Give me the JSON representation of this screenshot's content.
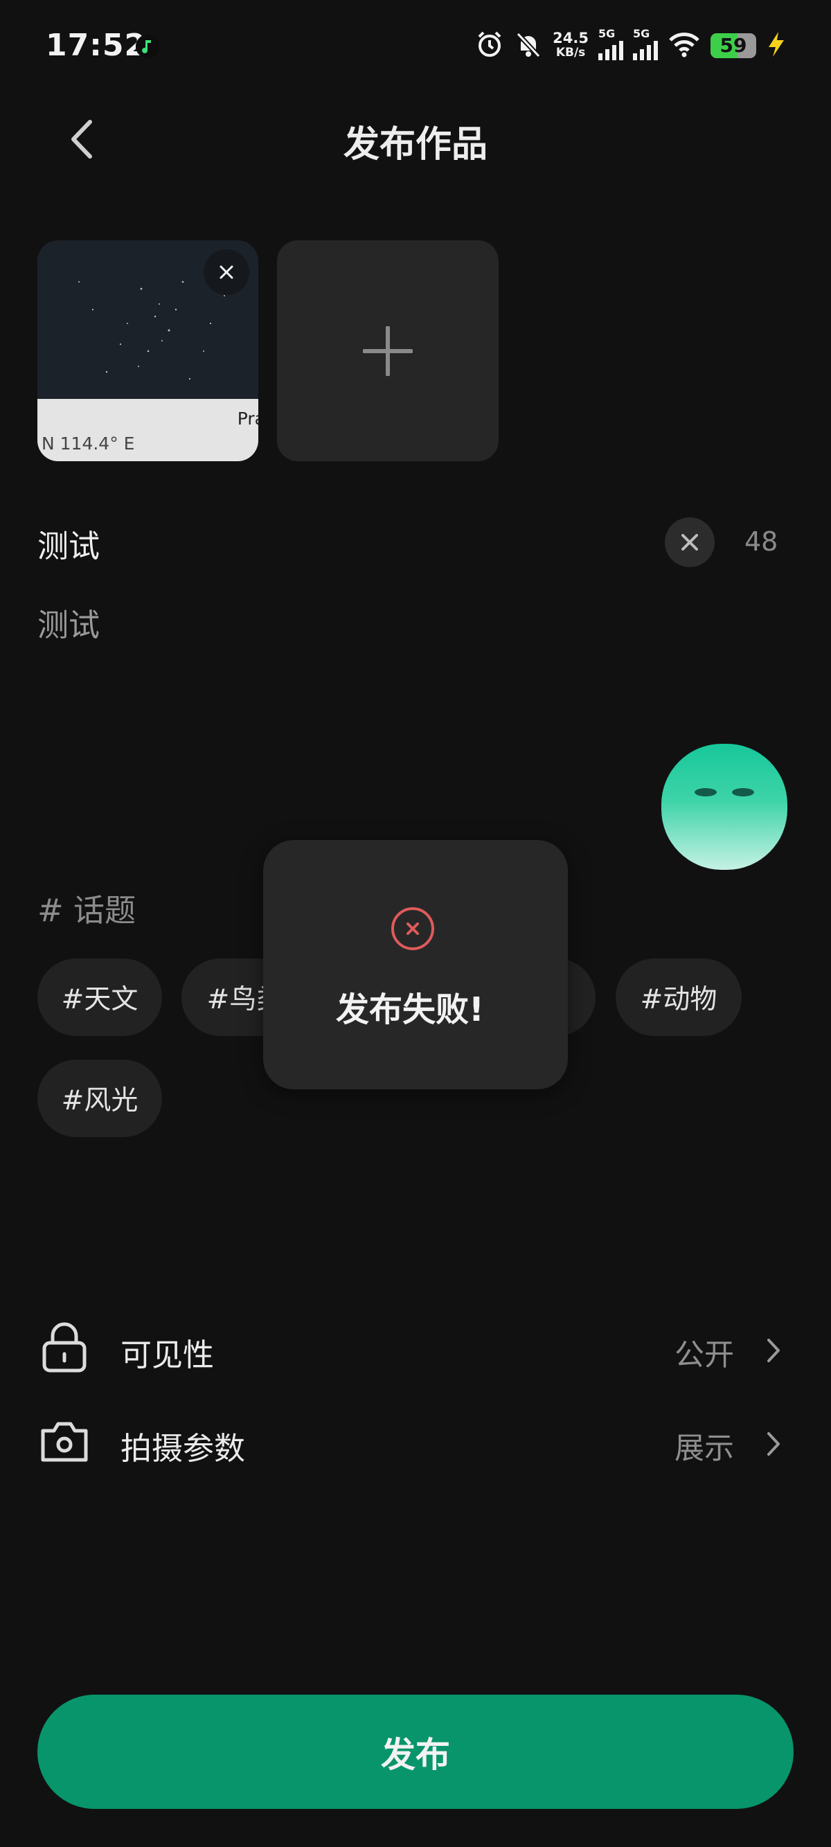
{
  "status_bar": {
    "time": "17:52",
    "net_speed_value": "24.5",
    "net_speed_unit": "KB/s",
    "signal1_label": "5G",
    "signal2_label": "5G",
    "battery_level": "59",
    "icons": [
      "music-app-icon",
      "alarm-icon",
      "mute-icon",
      "signal-icon",
      "wifi-icon",
      "battery-icon",
      "charging-icon"
    ]
  },
  "header": {
    "title": "发布作品"
  },
  "photos": {
    "thumb_text_1": "Pra",
    "thumb_text_2": "N 114.4° E"
  },
  "post": {
    "title": "测试",
    "char_count": "48",
    "description": "测试"
  },
  "topics": {
    "heading": "# 话题",
    "chips": [
      "#天文",
      "#鸟类",
      "",
      "#动物",
      "#风光"
    ]
  },
  "toast": {
    "message": "发布失败!"
  },
  "settings": {
    "visibility_label": "可见性",
    "visibility_value": "公开",
    "shooting_label": "拍摄参数",
    "shooting_value": "展示"
  },
  "publish_button": "发布",
  "colors": {
    "accent": "#08956b",
    "error": "#e05a5a",
    "background": "#111111"
  }
}
